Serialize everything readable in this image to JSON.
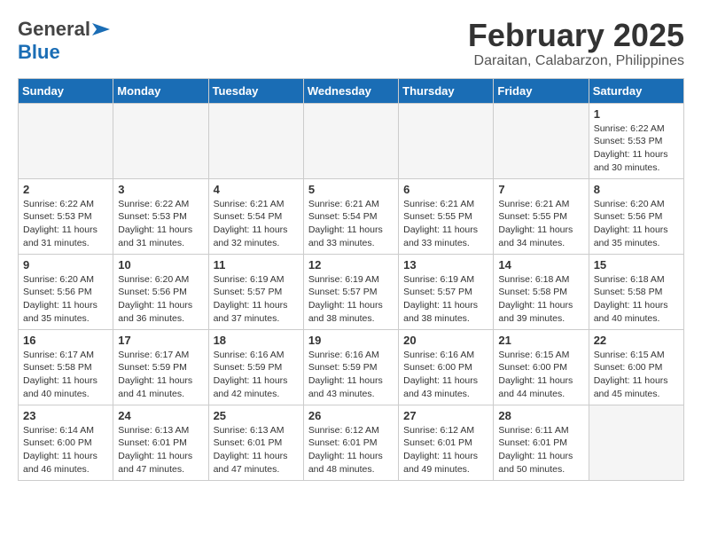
{
  "header": {
    "logo_general": "General",
    "logo_blue": "Blue",
    "month": "February 2025",
    "location": "Daraitan, Calabarzon, Philippines"
  },
  "weekdays": [
    "Sunday",
    "Monday",
    "Tuesday",
    "Wednesday",
    "Thursday",
    "Friday",
    "Saturday"
  ],
  "weeks": [
    [
      {
        "day": "",
        "empty": true
      },
      {
        "day": "",
        "empty": true
      },
      {
        "day": "",
        "empty": true
      },
      {
        "day": "",
        "empty": true
      },
      {
        "day": "",
        "empty": true
      },
      {
        "day": "",
        "empty": true
      },
      {
        "day": "1",
        "sunrise": "6:22 AM",
        "sunset": "5:53 PM",
        "daylight": "11 hours and 30 minutes."
      }
    ],
    [
      {
        "day": "2",
        "sunrise": "6:22 AM",
        "sunset": "5:53 PM",
        "daylight": "11 hours and 31 minutes."
      },
      {
        "day": "3",
        "sunrise": "6:22 AM",
        "sunset": "5:53 PM",
        "daylight": "11 hours and 31 minutes."
      },
      {
        "day": "4",
        "sunrise": "6:21 AM",
        "sunset": "5:54 PM",
        "daylight": "11 hours and 32 minutes."
      },
      {
        "day": "5",
        "sunrise": "6:21 AM",
        "sunset": "5:54 PM",
        "daylight": "11 hours and 33 minutes."
      },
      {
        "day": "6",
        "sunrise": "6:21 AM",
        "sunset": "5:55 PM",
        "daylight": "11 hours and 33 minutes."
      },
      {
        "day": "7",
        "sunrise": "6:21 AM",
        "sunset": "5:55 PM",
        "daylight": "11 hours and 34 minutes."
      },
      {
        "day": "8",
        "sunrise": "6:20 AM",
        "sunset": "5:56 PM",
        "daylight": "11 hours and 35 minutes."
      }
    ],
    [
      {
        "day": "9",
        "sunrise": "6:20 AM",
        "sunset": "5:56 PM",
        "daylight": "11 hours and 35 minutes."
      },
      {
        "day": "10",
        "sunrise": "6:20 AM",
        "sunset": "5:56 PM",
        "daylight": "11 hours and 36 minutes."
      },
      {
        "day": "11",
        "sunrise": "6:19 AM",
        "sunset": "5:57 PM",
        "daylight": "11 hours and 37 minutes."
      },
      {
        "day": "12",
        "sunrise": "6:19 AM",
        "sunset": "5:57 PM",
        "daylight": "11 hours and 38 minutes."
      },
      {
        "day": "13",
        "sunrise": "6:19 AM",
        "sunset": "5:57 PM",
        "daylight": "11 hours and 38 minutes."
      },
      {
        "day": "14",
        "sunrise": "6:18 AM",
        "sunset": "5:58 PM",
        "daylight": "11 hours and 39 minutes."
      },
      {
        "day": "15",
        "sunrise": "6:18 AM",
        "sunset": "5:58 PM",
        "daylight": "11 hours and 40 minutes."
      }
    ],
    [
      {
        "day": "16",
        "sunrise": "6:17 AM",
        "sunset": "5:58 PM",
        "daylight": "11 hours and 40 minutes."
      },
      {
        "day": "17",
        "sunrise": "6:17 AM",
        "sunset": "5:59 PM",
        "daylight": "11 hours and 41 minutes."
      },
      {
        "day": "18",
        "sunrise": "6:16 AM",
        "sunset": "5:59 PM",
        "daylight": "11 hours and 42 minutes."
      },
      {
        "day": "19",
        "sunrise": "6:16 AM",
        "sunset": "5:59 PM",
        "daylight": "11 hours and 43 minutes."
      },
      {
        "day": "20",
        "sunrise": "6:16 AM",
        "sunset": "6:00 PM",
        "daylight": "11 hours and 43 minutes."
      },
      {
        "day": "21",
        "sunrise": "6:15 AM",
        "sunset": "6:00 PM",
        "daylight": "11 hours and 44 minutes."
      },
      {
        "day": "22",
        "sunrise": "6:15 AM",
        "sunset": "6:00 PM",
        "daylight": "11 hours and 45 minutes."
      }
    ],
    [
      {
        "day": "23",
        "sunrise": "6:14 AM",
        "sunset": "6:00 PM",
        "daylight": "11 hours and 46 minutes."
      },
      {
        "day": "24",
        "sunrise": "6:13 AM",
        "sunset": "6:01 PM",
        "daylight": "11 hours and 47 minutes."
      },
      {
        "day": "25",
        "sunrise": "6:13 AM",
        "sunset": "6:01 PM",
        "daylight": "11 hours and 47 minutes."
      },
      {
        "day": "26",
        "sunrise": "6:12 AM",
        "sunset": "6:01 PM",
        "daylight": "11 hours and 48 minutes."
      },
      {
        "day": "27",
        "sunrise": "6:12 AM",
        "sunset": "6:01 PM",
        "daylight": "11 hours and 49 minutes."
      },
      {
        "day": "28",
        "sunrise": "6:11 AM",
        "sunset": "6:01 PM",
        "daylight": "11 hours and 50 minutes."
      },
      {
        "day": "",
        "empty": true
      }
    ]
  ],
  "labels": {
    "sunrise": "Sunrise:",
    "sunset": "Sunset:",
    "daylight": "Daylight:"
  }
}
